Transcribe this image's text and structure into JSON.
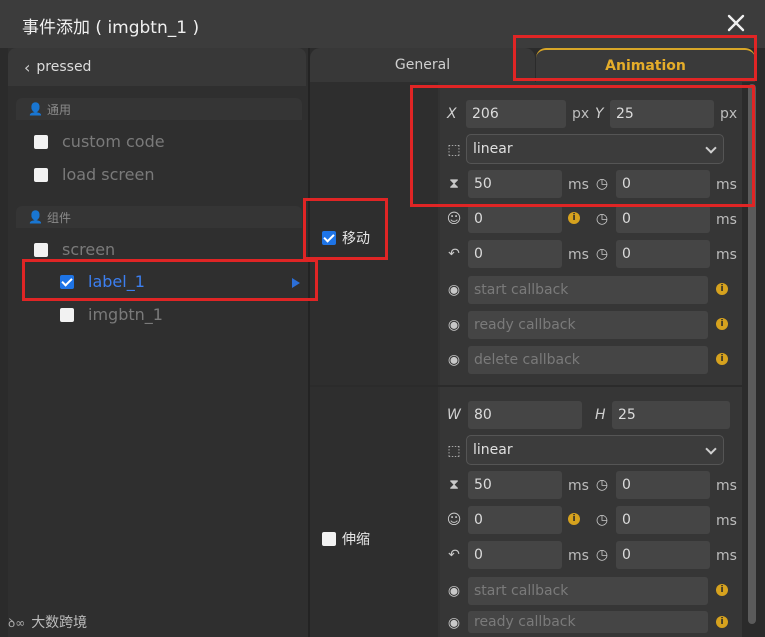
{
  "window": {
    "title": "事件添加 ( imgbtn_1 )"
  },
  "left_panel": {
    "back_label": "pressed",
    "groups": [
      {
        "label": "通用",
        "items": [
          {
            "label": "custom code",
            "checked": false
          },
          {
            "label": "load screen",
            "checked": false
          }
        ]
      },
      {
        "label": "组件",
        "items": [
          {
            "label": "screen",
            "checked": false
          },
          {
            "label": "label_1",
            "checked": true,
            "selected": true
          },
          {
            "label": "imgbtn_1",
            "checked": false
          }
        ]
      }
    ]
  },
  "tabs": {
    "general": "General",
    "animation": "Animation",
    "active": "Animation"
  },
  "move": {
    "label": "移动",
    "checked": true,
    "x_label": "X",
    "x": "206",
    "x_unit": "px",
    "y_label": "Y",
    "y": "25",
    "y_unit": "px",
    "easing": "linear",
    "duration": "50",
    "duration_unit": "ms",
    "delay": "0",
    "delay_unit": "ms",
    "repeat": "0",
    "repeat_delay": "0",
    "repeat_delay_unit": "ms",
    "playback": "0",
    "playback_unit": "ms",
    "playback_delay": "0",
    "playback_delay_unit": "ms",
    "start_callback": "start callback",
    "ready_callback": "ready callback",
    "delete_callback": "delete callback"
  },
  "scale": {
    "label": "伸缩",
    "checked": false,
    "w_label": "W",
    "w": "80",
    "h_label": "H",
    "h": "25",
    "easing": "linear",
    "duration": "50",
    "duration_unit": "ms",
    "delay": "0",
    "delay_unit": "ms",
    "repeat": "0",
    "repeat_delay": "0",
    "repeat_delay_unit": "ms",
    "playback": "0",
    "playback_unit": "ms",
    "playback_delay": "0",
    "playback_delay_unit": "ms",
    "start_callback": "start callback",
    "ready_callback": "ready callback"
  },
  "watermark": "大数跨境",
  "colors": {
    "accent": "#e5ad2a",
    "highlight": "#e02525",
    "selection": "#3c7ff0"
  }
}
